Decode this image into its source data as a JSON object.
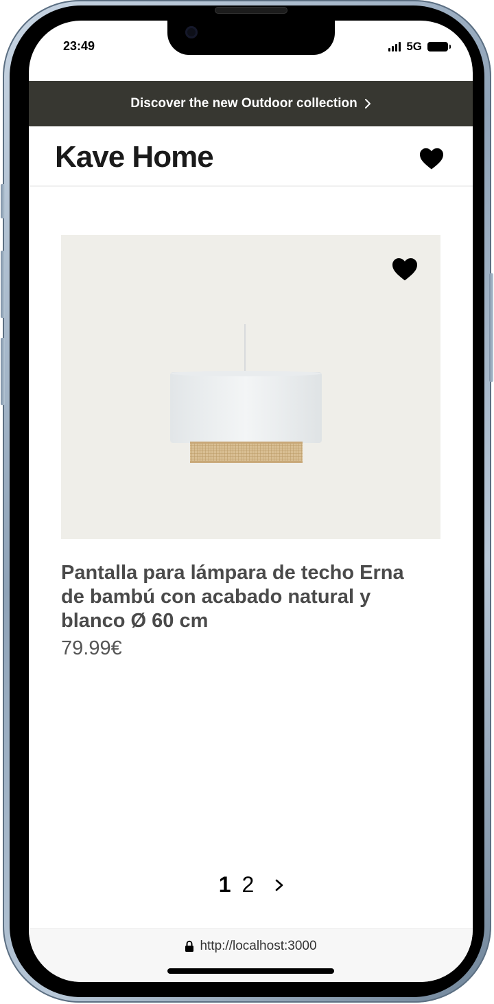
{
  "status_bar": {
    "time": "23:49",
    "network": "5G"
  },
  "promo_banner": {
    "text": "Discover the new Outdoor collection"
  },
  "header": {
    "logo": "Kave Home"
  },
  "product": {
    "title": "Pantalla para lámpara de techo Erna de bambú con acabado natural y blanco Ø 60 cm",
    "price": "79.99€"
  },
  "pagination": {
    "pages": [
      "1",
      "2"
    ],
    "current": "1"
  },
  "browser": {
    "url": "http://localhost:3000"
  },
  "colors": {
    "banner_bg": "#373731",
    "image_bg": "#efeee9",
    "text_dark": "#4a4a4a"
  },
  "icons": [
    "heart-icon",
    "chevron-right-icon",
    "lock-icon",
    "battery-icon",
    "signal-icon"
  ]
}
